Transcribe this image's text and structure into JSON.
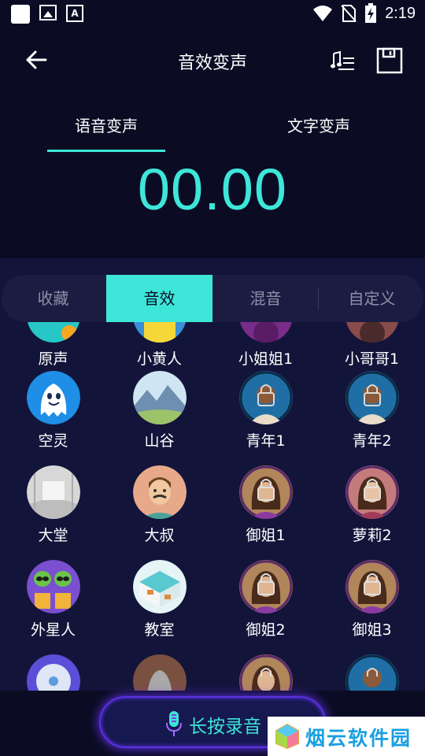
{
  "status_bar": {
    "time": "2:19",
    "icons": [
      "notification-square-icon",
      "image-icon",
      "text-a-icon",
      "wifi-icon",
      "no-sim-icon",
      "battery-charging-icon"
    ]
  },
  "header": {
    "title": "音效变声",
    "icons": [
      "back-arrow-icon",
      "music-list-icon",
      "save-icon"
    ],
    "tabs": [
      {
        "label": "语音变声",
        "active": true
      },
      {
        "label": "文字变声",
        "active": false
      }
    ],
    "timer": "00.00"
  },
  "categories": [
    {
      "label": "收藏",
      "active": false
    },
    {
      "label": "音效",
      "active": true
    },
    {
      "label": "混音",
      "active": false
    },
    {
      "label": "自定义",
      "active": false
    }
  ],
  "effects": [
    {
      "label": "原声",
      "icon": "original-voice-icon",
      "locked": false
    },
    {
      "label": "小黄人",
      "icon": "minion-icon",
      "locked": false
    },
    {
      "label": "小姐姐1",
      "icon": "young-woman-avatar-icon",
      "locked": true
    },
    {
      "label": "小哥哥1",
      "icon": "young-man-avatar-icon",
      "locked": true
    },
    {
      "label": "空灵",
      "icon": "ghost-icon",
      "locked": false
    },
    {
      "label": "山谷",
      "icon": "valley-icon",
      "locked": false
    },
    {
      "label": "青年1",
      "icon": "young-man-avatar-icon",
      "locked": true
    },
    {
      "label": "青年2",
      "icon": "young-man-avatar-icon",
      "locked": true
    },
    {
      "label": "大堂",
      "icon": "hall-icon",
      "locked": false
    },
    {
      "label": "大叔",
      "icon": "uncle-icon",
      "locked": false
    },
    {
      "label": "御姐1",
      "icon": "mature-woman-avatar-icon",
      "locked": true
    },
    {
      "label": "萝莉2",
      "icon": "girl-avatar-icon",
      "locked": true
    },
    {
      "label": "外星人",
      "icon": "alien-icon",
      "locked": false
    },
    {
      "label": "教室",
      "icon": "classroom-icon",
      "locked": false
    },
    {
      "label": "御姐2",
      "icon": "mature-woman-avatar-icon",
      "locked": true
    },
    {
      "label": "御姐3",
      "icon": "mature-woman-avatar-icon",
      "locked": true
    },
    {
      "label": "",
      "icon": "fan-icon",
      "locked": false
    },
    {
      "label": "",
      "icon": "cave-icon",
      "locked": false
    },
    {
      "label": "",
      "icon": "mature-woman-avatar-icon",
      "locked": true
    },
    {
      "label": "",
      "icon": "young-man-avatar-icon",
      "locked": true
    }
  ],
  "record_button": {
    "label": "长按录音",
    "icon": "microphone-icon"
  },
  "watermark": {
    "text": "烟云软件园"
  },
  "colors": {
    "accent": "#3de6d8",
    "background": "#13143a",
    "header_bg": "#0b0c24",
    "record_glow": "#6a35ff"
  }
}
